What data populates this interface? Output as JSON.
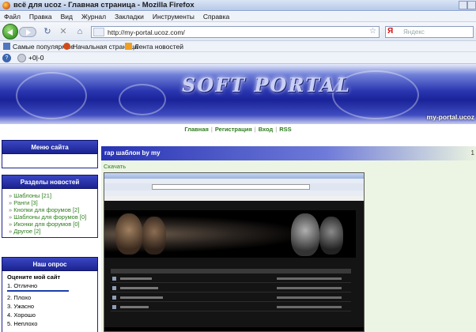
{
  "window": {
    "title": "всё для ucoz - Главная страница - Mozilla Firefox"
  },
  "menu": [
    "Файл",
    "Правка",
    "Вид",
    "Журнал",
    "Закладки",
    "Инструменты",
    "Справка"
  ],
  "address": {
    "url": "http://my-portal.ucoz.com/"
  },
  "search": {
    "engine": "Я",
    "placeholder": "Яндекс"
  },
  "bookmarks": [
    {
      "label": "Самые популярные",
      "icon": "bookmark-icon"
    },
    {
      "label": "Начальная страница",
      "icon": "firefox-icon"
    },
    {
      "label": "Лента новостей",
      "icon": "rss-icon"
    }
  ],
  "extra_toolbar": {
    "value": "+0|-0"
  },
  "site": {
    "logo": "SOFT PORTAL",
    "domain": "my-portal.ucoz",
    "nav": [
      "Главная",
      "Регистрация",
      "Вход",
      "RSS"
    ]
  },
  "sidebar": {
    "menu_title": "Меню сайта",
    "news_title": "Разделы новостей",
    "categories": [
      "Шаблоны [21]",
      "Ранги [3]",
      "Кнопки для форумов [2]",
      "Шаблоны для форумов [0]",
      "Иконки для форумов [0]",
      "Другое [2]"
    ],
    "poll_title": "Наш опрос",
    "poll_question": "Оцените мой сайт",
    "poll_options": [
      "1. Отлично",
      "2. Плохо",
      "3. Ужасно",
      "4. Хорошо",
      "5. Неплохо"
    ]
  },
  "main": {
    "title": "rap шаблон by my",
    "right_marker": "1",
    "download": "Скачать"
  },
  "colors": {
    "header_blue": "#1a2399",
    "link_green": "#2e7d1f",
    "main_bg": "#ecf5e4"
  }
}
